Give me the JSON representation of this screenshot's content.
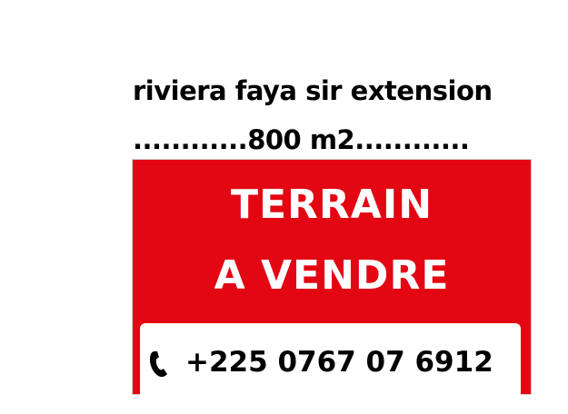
{
  "caption": {
    "line1": "riviera faya sir extension",
    "line2": "............800 m2............"
  },
  "sign": {
    "title_line1": "TERRAIN",
    "title_line2": "A VENDRE",
    "phone": "+225 0767 07 6912",
    "phone_icon": "phone-icon",
    "background_color": "#e30613",
    "text_color": "#ffffff"
  }
}
